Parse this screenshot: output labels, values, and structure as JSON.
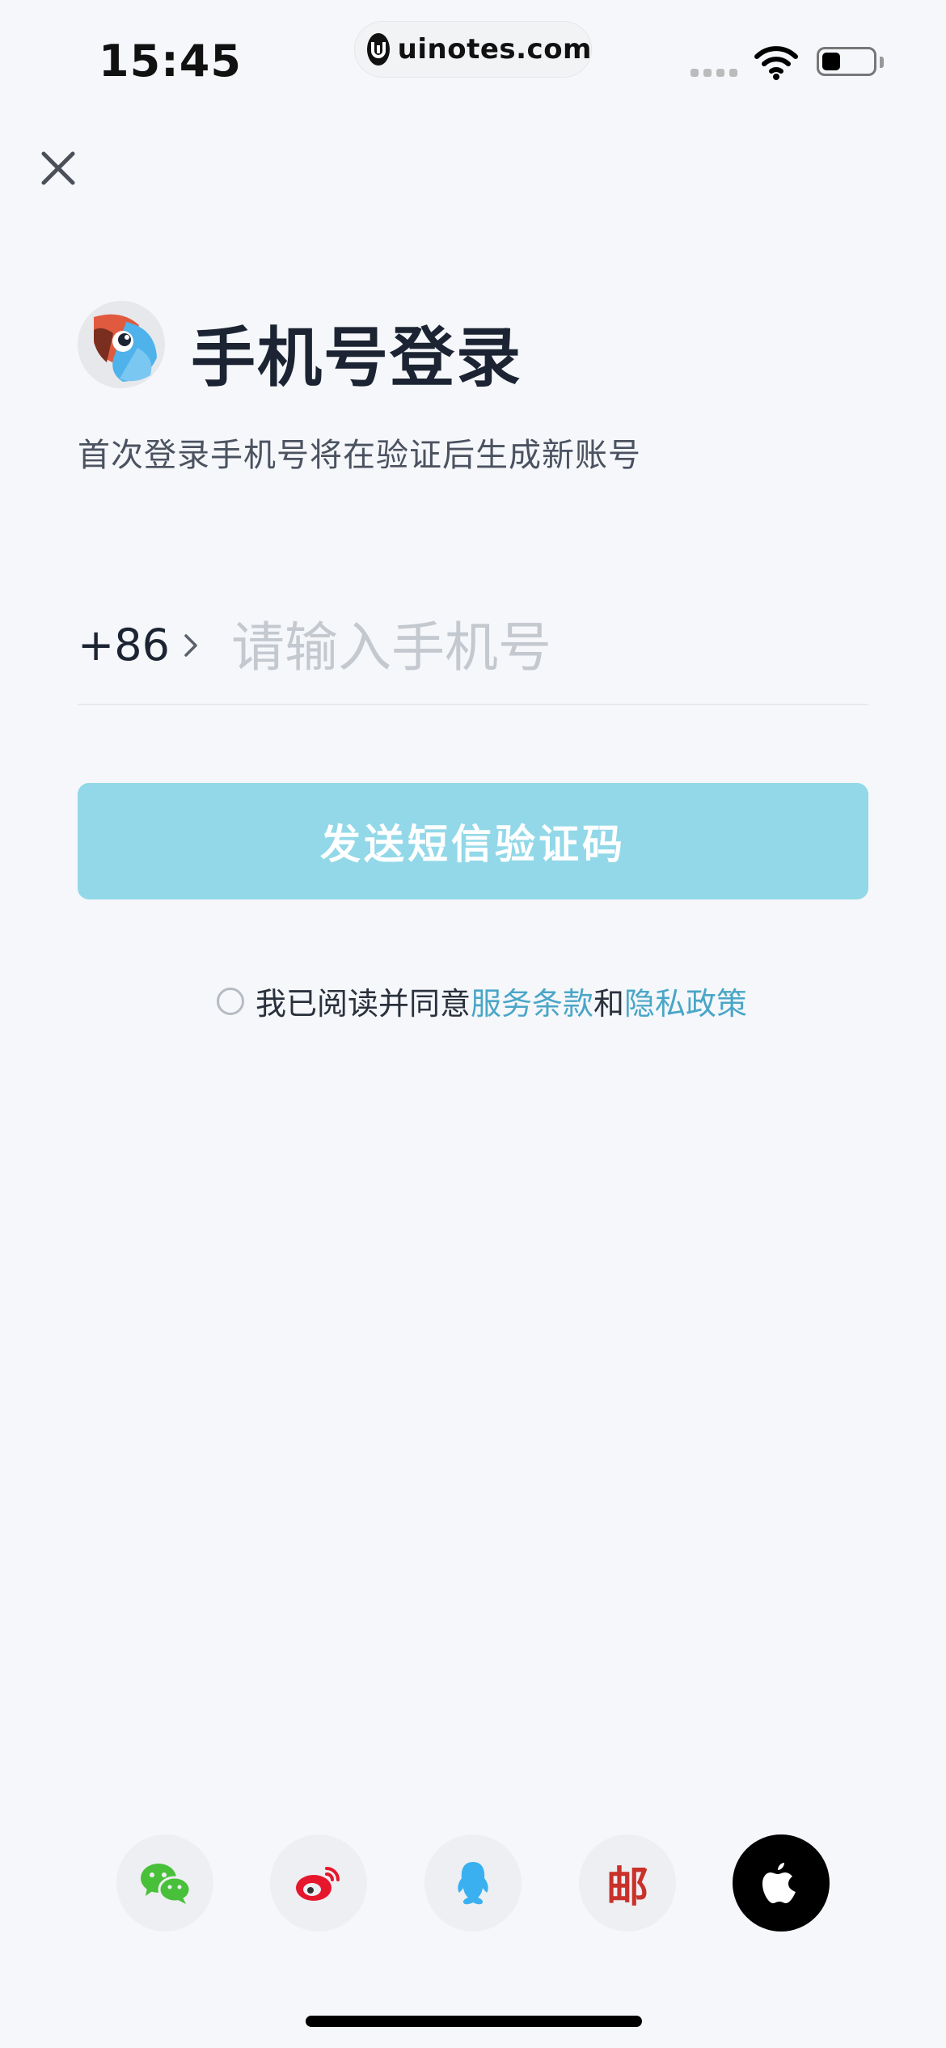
{
  "status_bar": {
    "time": "15:45",
    "site": "uinotes.com"
  },
  "header": {
    "title": "手机号登录",
    "subtitle": "首次登录手机号将在验证后生成新账号"
  },
  "phone": {
    "country_code": "+86",
    "placeholder": "请输入手机号",
    "value": ""
  },
  "send_button": {
    "label": "发送短信验证码"
  },
  "agreement": {
    "prefix": "我已阅读并同意",
    "terms": "服务条款",
    "and": "和",
    "privacy": "隐私政策",
    "checked": false
  },
  "social_login": [
    "wechat-icon",
    "weibo-icon",
    "qq-icon",
    "email-icon",
    "apple-icon"
  ],
  "social_email_glyph": "邮",
  "colors": {
    "background": "#f5f7fa",
    "primary_button": "#92d8e8",
    "link": "#4aa6c7",
    "title": "#1c2433"
  }
}
